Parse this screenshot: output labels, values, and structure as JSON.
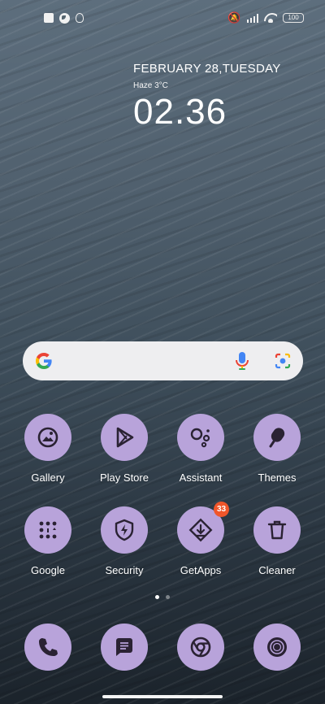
{
  "status_bar": {
    "left_icons": [
      "notification-square-icon",
      "app-notification-icon",
      "bulb-icon"
    ],
    "right_icons": [
      "mute-icon",
      "signal-icon",
      "wifi-icon",
      "battery-icon"
    ],
    "battery": "100"
  },
  "clock_widget": {
    "date": "FEBRUARY 28,TUESDAY",
    "weather": "Haze 3°C",
    "time": "02.36"
  },
  "search_bar": {
    "icons": [
      "google-logo-icon",
      "microphone-icon",
      "google-lens-icon"
    ]
  },
  "apps": [
    {
      "label": "Gallery",
      "icon": "gallery-icon"
    },
    {
      "label": "Play Store",
      "icon": "play-store-icon"
    },
    {
      "label": "Assistant",
      "icon": "assistant-icon"
    },
    {
      "label": "Themes",
      "icon": "themes-icon"
    },
    {
      "label": "Google",
      "icon": "google-folder-icon"
    },
    {
      "label": "Security",
      "icon": "security-icon"
    },
    {
      "label": "GetApps",
      "icon": "getapps-icon",
      "badge": "33"
    },
    {
      "label": "Cleaner",
      "icon": "cleaner-icon"
    }
  ],
  "dock": [
    {
      "icon": "phone-icon"
    },
    {
      "icon": "messages-icon"
    },
    {
      "icon": "chrome-icon"
    },
    {
      "icon": "camera-icon"
    }
  ],
  "page_indicator": {
    "total": 2,
    "active": 1
  },
  "colors": {
    "icon_background": "#b8a3da",
    "icon_foreground": "#2a2233",
    "badge": "#f0562a",
    "search_background": "#eeeef0"
  }
}
